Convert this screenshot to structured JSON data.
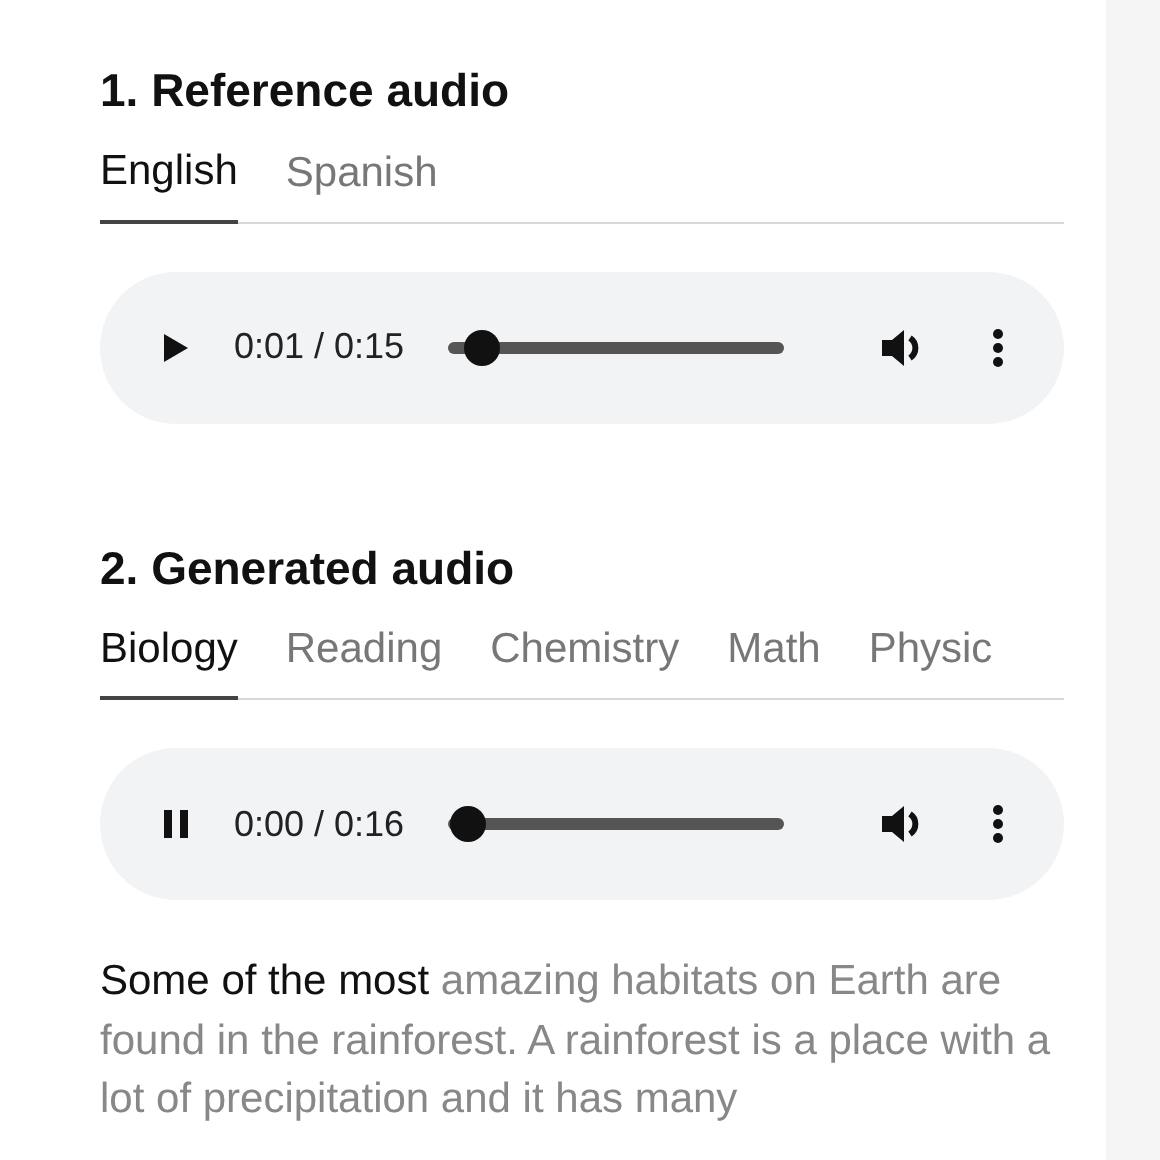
{
  "sections": [
    {
      "title": "1. Reference audio",
      "tabs": [
        {
          "label": "English",
          "selected": true
        },
        {
          "label": "Spanish",
          "selected": false
        }
      ],
      "player": {
        "playing": false,
        "time": "0:01 / 0:15",
        "level": 0.1
      }
    },
    {
      "title": "2. Generated audio",
      "tabs": [
        {
          "label": "Biology",
          "selected": true
        },
        {
          "label": "Reading",
          "selected": false
        },
        {
          "label": "Chemistry",
          "selected": false
        },
        {
          "label": "Math",
          "selected": false
        },
        {
          "label": "Physic",
          "selected": false
        }
      ],
      "player": {
        "playing": true,
        "time": "0:00 / 0:16",
        "level": 0.06
      }
    }
  ],
  "transcript": {
    "spoken": "Some of the most",
    "unspoken": "amazing habitats on Earth are found in the rainforest. A rainforest is a place with a lot of precipitation and it has many"
  }
}
